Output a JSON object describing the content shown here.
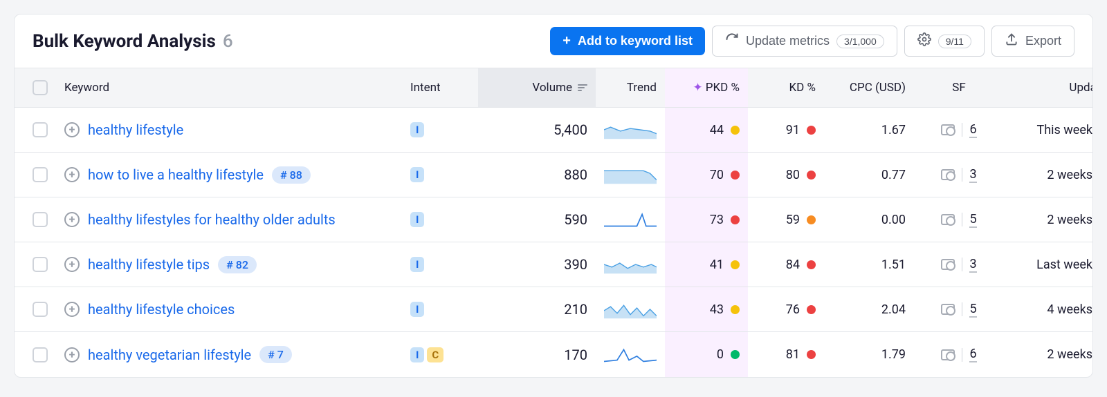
{
  "header": {
    "title": "Bulk Keyword Analysis",
    "count": "6",
    "add_button": "Add to keyword list",
    "update_button": "Update metrics",
    "update_pill": "3/1,000",
    "settings_pill": "9/11",
    "export_button": "Export"
  },
  "columns": {
    "keyword": "Keyword",
    "intent": "Intent",
    "volume": "Volume",
    "trend": "Trend",
    "pkd": "PKD %",
    "kd": "KD %",
    "cpc": "CPC (USD)",
    "sf": "SF",
    "updated": "Updated"
  },
  "rows": [
    {
      "keyword": "healthy lifestyle",
      "rank": null,
      "intents": [
        "I"
      ],
      "volume": "5,400",
      "trend": "area-flat",
      "pkd": "44",
      "pkd_dot": "dot-yellow",
      "kd": "91",
      "kd_dot": "dot-red",
      "cpc": "1.67",
      "sf": "6",
      "updated": "This week"
    },
    {
      "keyword": "how to live a healthy lifestyle",
      "rank": "# 88",
      "intents": [
        "I"
      ],
      "volume": "880",
      "trend": "area-dip",
      "pkd": "70",
      "pkd_dot": "dot-red",
      "kd": "80",
      "kd_dot": "dot-red",
      "cpc": "0.77",
      "sf": "3",
      "updated": "2 weeks"
    },
    {
      "keyword": "healthy lifestyles for healthy older adults",
      "rank": null,
      "intents": [
        "I"
      ],
      "volume": "590",
      "trend": "line-spike",
      "pkd": "73",
      "pkd_dot": "dot-red",
      "kd": "59",
      "kd_dot": "dot-orange",
      "cpc": "0.00",
      "sf": "5",
      "updated": "2 weeks"
    },
    {
      "keyword": "healthy lifestyle tips",
      "rank": "# 82",
      "intents": [
        "I"
      ],
      "volume": "390",
      "trend": "area-wavy",
      "pkd": "41",
      "pkd_dot": "dot-yellow",
      "kd": "84",
      "kd_dot": "dot-red",
      "cpc": "1.51",
      "sf": "3",
      "updated": "Last week"
    },
    {
      "keyword": "healthy lifestyle choices",
      "rank": null,
      "intents": [
        "I"
      ],
      "volume": "210",
      "trend": "area-noise",
      "pkd": "43",
      "pkd_dot": "dot-yellow",
      "kd": "76",
      "kd_dot": "dot-red",
      "cpc": "2.04",
      "sf": "5",
      "updated": "4 weeks"
    },
    {
      "keyword": "healthy vegetarian lifestyle",
      "rank": "# 7",
      "intents": [
        "I",
        "C"
      ],
      "volume": "170",
      "trend": "line-peak",
      "pkd": "0",
      "pkd_dot": "dot-green",
      "kd": "81",
      "kd_dot": "dot-red",
      "cpc": "1.79",
      "sf": "6",
      "updated": "2 weeks"
    }
  ]
}
